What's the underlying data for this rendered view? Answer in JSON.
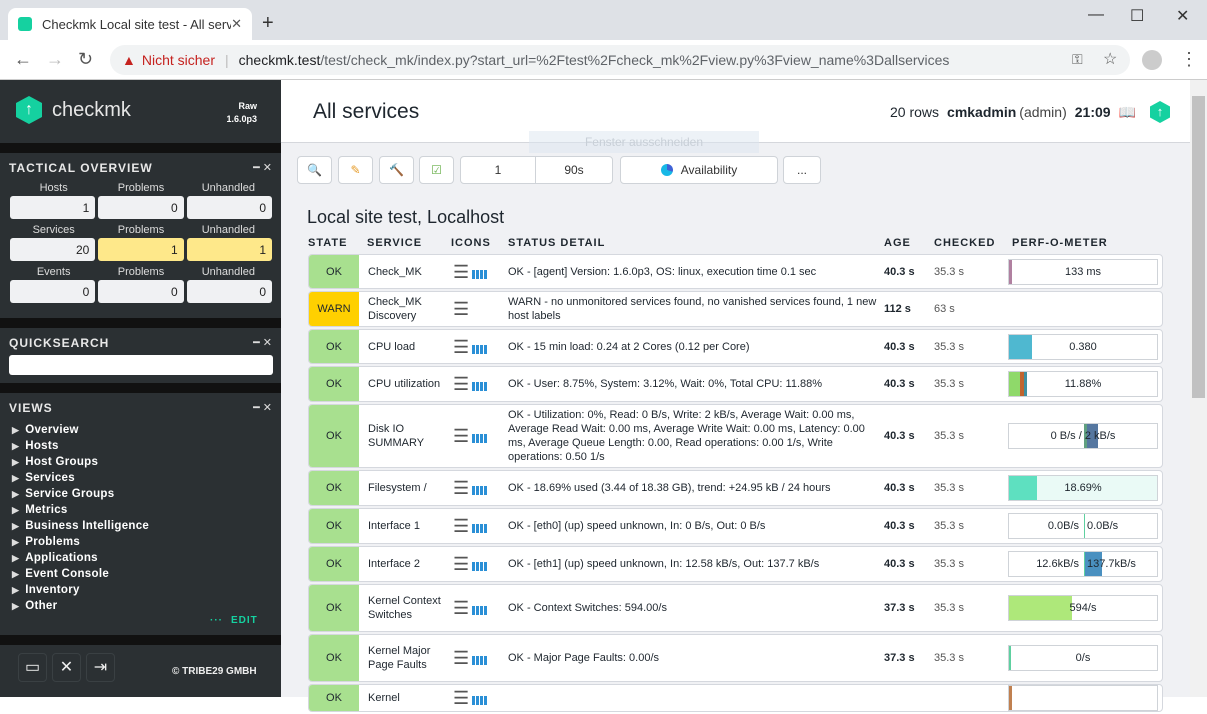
{
  "browser": {
    "tab_title": "Checkmk Local site test - All servi",
    "not_secure": "Nicht sicher",
    "url_host": "checkmk.test",
    "url_rest": "/test/check_mk/index.py?start_url=%2Ftest%2Fcheck_mk%2Fview.py%3Fview_name%3Dallservices"
  },
  "sidebar": {
    "logo": "checkmk",
    "edition": "Raw",
    "version": "1.6.0p3",
    "tactical": {
      "title": "TACTICAL OVERVIEW",
      "rows": [
        {
          "labels": [
            "Hosts",
            "Problems",
            "Unhandled"
          ],
          "values": [
            "1",
            "0",
            "0"
          ],
          "highlight": [
            false,
            false,
            false
          ]
        },
        {
          "labels": [
            "Services",
            "Problems",
            "Unhandled"
          ],
          "values": [
            "20",
            "1",
            "1"
          ],
          "highlight": [
            false,
            true,
            true
          ]
        },
        {
          "labels": [
            "Events",
            "Problems",
            "Unhandled"
          ],
          "values": [
            "0",
            "0",
            "0"
          ],
          "highlight": [
            false,
            false,
            false
          ]
        }
      ]
    },
    "quicksearch": {
      "title": "QUICKSEARCH",
      "value": ""
    },
    "views": {
      "title": "VIEWS",
      "items": [
        "Overview",
        "Hosts",
        "Host Groups",
        "Services",
        "Service Groups",
        "Metrics",
        "Business Intelligence",
        "Problems",
        "Applications",
        "Event Console",
        "Inventory",
        "Other"
      ],
      "edit": "EDIT"
    },
    "copyright": "© TRIBE29 GMBH"
  },
  "header": {
    "title": "All services",
    "rows": "20 rows",
    "user": "cmkadmin",
    "role": "(admin)",
    "time": "21:09",
    "tooltip": "Fenster ausschneiden"
  },
  "toolbar": {
    "refresh_count": "1",
    "refresh_interval": "90s",
    "availability": "Availability",
    "more": "..."
  },
  "table": {
    "title": "Local site test, Localhost",
    "columns": [
      "STATE",
      "SERVICE",
      "ICONS",
      "STATUS DETAIL",
      "AGE",
      "CHECKED",
      "PERF-O-METER"
    ],
    "colors": {
      "OK": "#a8e08f",
      "WARN": "#ffd000"
    },
    "rows": [
      {
        "state": "OK",
        "service": "Check_MK",
        "graph": true,
        "detail": "OK - [agent] Version: 1.6.0p3, OS: linux, execution time 0.1 sec",
        "age": "40.3 s",
        "checked": "35.3 s",
        "perf": {
          "label": "133 ms",
          "segs": [
            [
              0.02,
              "#b080a0"
            ]
          ]
        }
      },
      {
        "state": "WARN",
        "service": "Check_MK Discovery",
        "graph": false,
        "detail": "WARN - no unmonitored services found, no vanished services found, 1 new host labels",
        "age": "112 s",
        "checked": "63 s",
        "perf": null
      },
      {
        "state": "OK",
        "service": "CPU load",
        "graph": true,
        "detail": "OK - 15 min load: 0.24 at 2 Cores (0.12 per Core)",
        "age": "40.3 s",
        "checked": "35.3 s",
        "perf": {
          "label": "0.380",
          "segs": [
            [
              0.155,
              "#4fb8d0"
            ]
          ]
        }
      },
      {
        "state": "OK",
        "service": "CPU utilization",
        "graph": true,
        "detail": "OK - User: 8.75%, System: 3.12%, Wait: 0%, Total CPU: 11.88%",
        "age": "40.3 s",
        "checked": "35.3 s",
        "perf": {
          "label": "11.88%",
          "segs": [
            [
              0.075,
              "#8fd96a"
            ],
            [
              0.025,
              "#c0642f"
            ],
            [
              0.02,
              "#3f8fa0"
            ]
          ]
        }
      },
      {
        "state": "OK",
        "service": "Disk IO SUMMARY",
        "graph": true,
        "detail": "OK - Utilization: 0%, Read: 0 B/s, Write: 2 kB/s, Average Wait: 0.00 ms, Average Read Wait: 0.00 ms, Average Write Wait: 0.00 ms, Latency: 0.00 ms, Average Queue Length: 0.00, Read operations: 0.00 1/s, Write operations: 0.50 1/s",
        "age": "40.3 s",
        "checked": "35.3 s",
        "perf": {
          "label": "0 B/s / 2 kB/s",
          "bidir": true,
          "right": [
            [
              0.02,
              "#60a080"
            ],
            [
              0.07,
              "#5577a0"
            ]
          ]
        }
      },
      {
        "state": "OK",
        "service": "Filesystem /",
        "graph": true,
        "detail": "OK - 18.69% used (3.44 of 18.38 GB), trend: +24.95 kB / 24 hours",
        "age": "40.3 s",
        "checked": "35.3 s",
        "perf": {
          "label": "18.69%",
          "bg": "#eafaf6",
          "segs": [
            [
              0.1869,
              "#5ee0c0"
            ]
          ]
        }
      },
      {
        "state": "OK",
        "service": "Interface 1",
        "graph": true,
        "detail": "OK - [eth0] (up) speed unknown, In: 0 B/s, Out: 0 B/s",
        "age": "40.3 s",
        "checked": "35.3 s",
        "perf": {
          "bidir": true,
          "left_label": "0.0B/s",
          "right_label": "0.0B/s",
          "right": [
            [
              0.005,
              "#5ed0a0"
            ]
          ]
        }
      },
      {
        "state": "OK",
        "service": "Interface 2",
        "graph": true,
        "detail": "OK - [eth1] (up) speed unknown, In: 12.58 kB/s, Out: 137.7 kB/s",
        "age": "40.3 s",
        "checked": "35.3 s",
        "perf": {
          "bidir": true,
          "left_label": "12.6kB/s",
          "right_label": "137.7kB/s",
          "right": [
            [
              0.005,
              "#5ed0a0"
            ],
            [
              0.11,
              "#4a90c0"
            ]
          ]
        }
      },
      {
        "state": "OK",
        "service": "Kernel Context Switches",
        "graph": true,
        "detail": "OK - Context Switches: 594.00/s",
        "age": "37.3 s",
        "checked": "35.3 s",
        "perf": {
          "label": "594/s",
          "segs": [
            [
              0.42,
              "#aee87a"
            ]
          ]
        }
      },
      {
        "state": "OK",
        "service": "Kernel Major Page Faults",
        "graph": true,
        "detail": "OK - Major Page Faults: 0.00/s",
        "age": "37.3 s",
        "checked": "35.3 s",
        "perf": {
          "label": "0/s",
          "segs": [
            [
              0.005,
              "#5ed0a0"
            ]
          ]
        }
      },
      {
        "state": "OK",
        "service": "Kernel",
        "graph": true,
        "detail": "",
        "age": "",
        "checked": "",
        "perf": {
          "label": "",
          "segs": [
            [
              0.02,
              "#c08050"
            ]
          ]
        }
      }
    ]
  }
}
